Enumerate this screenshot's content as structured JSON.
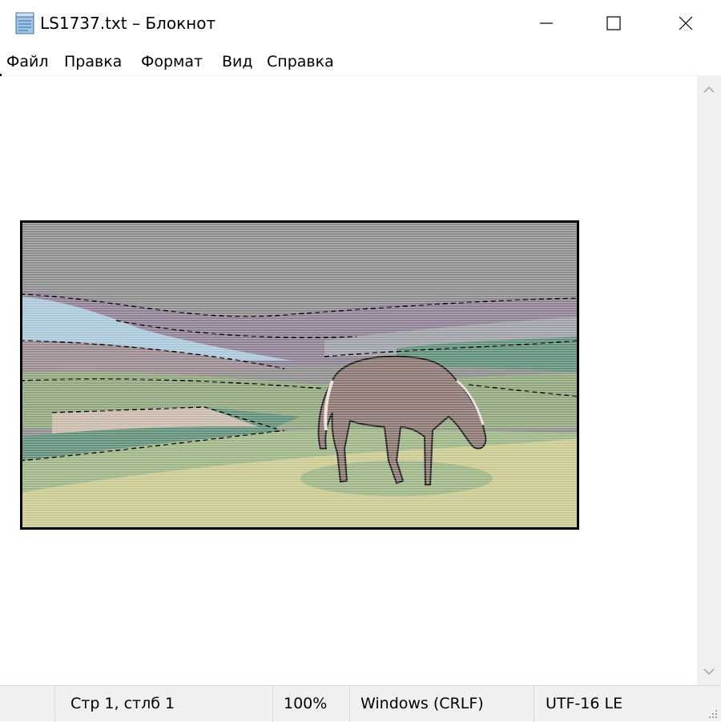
{
  "window": {
    "title": "LS1737.txt – Блокнот",
    "icon": "notepad-icon",
    "controls": [
      "minimize-icon",
      "maximize-icon",
      "close-icon"
    ]
  },
  "menu": {
    "items": [
      "Файл",
      "Правка",
      "Формат",
      "Вид",
      "Справка"
    ]
  },
  "editor": {
    "content": "ascii-art-horse-grazing-landscape"
  },
  "status": {
    "position": "Стр 1, стлб 1",
    "zoom": "100%",
    "line_endings": "Windows (CRLF)",
    "encoding": "UTF-16 LE"
  },
  "colors": {
    "sky": "#8c8c8c",
    "hill_purple": "#8e7f95",
    "hill_blue": "#a9c7d8",
    "field_green": "#8fa57b",
    "field_teal": "#5f8f78",
    "meadow_yellow": "#c9c98f",
    "horse_brown": "#8a7570",
    "frame": "#000000"
  }
}
